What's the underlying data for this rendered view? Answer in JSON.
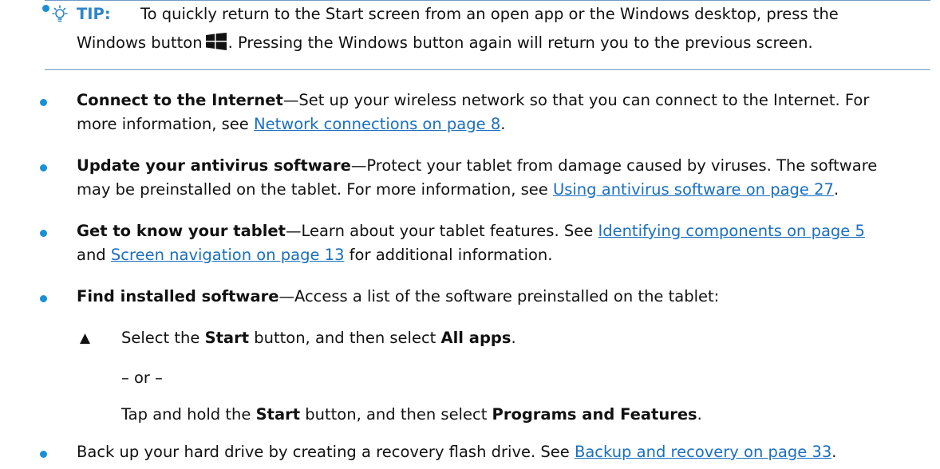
{
  "tip": {
    "label": "TIP:",
    "line1": "To quickly return to the Start screen from an open app or the Windows desktop, press the",
    "line2_before": "Windows button",
    "line2_after": ". Pressing the Windows button again will return you to the previous screen."
  },
  "items": [
    {
      "bold": "Connect to the Internet",
      "text": "—Set up your wireless network so that you can connect to the Internet. For",
      "line2_text": "more information, see ",
      "link": "Network connections on page 8",
      "line2_end": "."
    },
    {
      "bold": "Update your antivirus software",
      "text": "—Protect your tablet from damage caused by viruses. The software",
      "line2_text": "may be preinstalled on the tablet. For more information, see ",
      "link": "Using antivirus software on page 27",
      "line2_end": "."
    },
    {
      "bold": "Get to know your tablet",
      "text": "—Learn about your tablet features. See ",
      "link1": "Identifying components on page 5",
      "line2_text": "and ",
      "link2": "Screen navigation on page 13",
      "line2_end": " for additional information."
    },
    {
      "bold": "Find installed software",
      "text": "—Access a list of the software preinstalled on the tablet:"
    }
  ],
  "steps": {
    "s1_a": "Select the ",
    "s1_b": "Start",
    "s1_c": " button, and then select ",
    "s1_d": "All apps",
    "s1_e": ".",
    "or": "– or –",
    "s2_a": "Tap and hold the ",
    "s2_b": "Start",
    "s2_c": " button, and then select ",
    "s2_d": "Programs and Features",
    "s2_e": "."
  },
  "last": {
    "text": "Back up your hard drive by creating a recovery flash drive. See ",
    "link": "Backup and recovery on page 33",
    "end": "."
  },
  "colors": {
    "accent": "#2e86c9",
    "link": "#1a6fbf",
    "bullet": "#1b8fd6",
    "rule": "#6f9bc8"
  }
}
